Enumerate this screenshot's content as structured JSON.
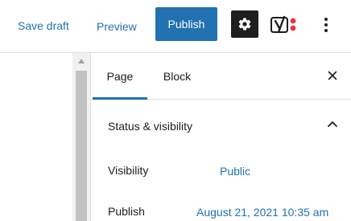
{
  "toolbar": {
    "save_draft_label": "Save draft",
    "preview_label": "Preview",
    "publish_label": "Publish",
    "settings_icon": "gear-icon",
    "yoast_icon": "yoast-icon",
    "more_icon": "vertical-ellipsis-icon"
  },
  "sidebar": {
    "tabs": [
      {
        "label": "Page",
        "active": true
      },
      {
        "label": "Block",
        "active": false
      }
    ],
    "close_icon": "close-icon",
    "panel": {
      "title": "Status & visibility",
      "expanded": true,
      "rows": [
        {
          "label": "Visibility",
          "value": "Public"
        },
        {
          "label": "Publish",
          "value": "August 21, 2021 10:35 am"
        }
      ]
    }
  },
  "colors": {
    "accent": "#2271b1",
    "text": "#1e1e1e",
    "dark_button": "#1e1e1e",
    "yoast_red": "#e5343a",
    "border": "#e0e0e0"
  }
}
